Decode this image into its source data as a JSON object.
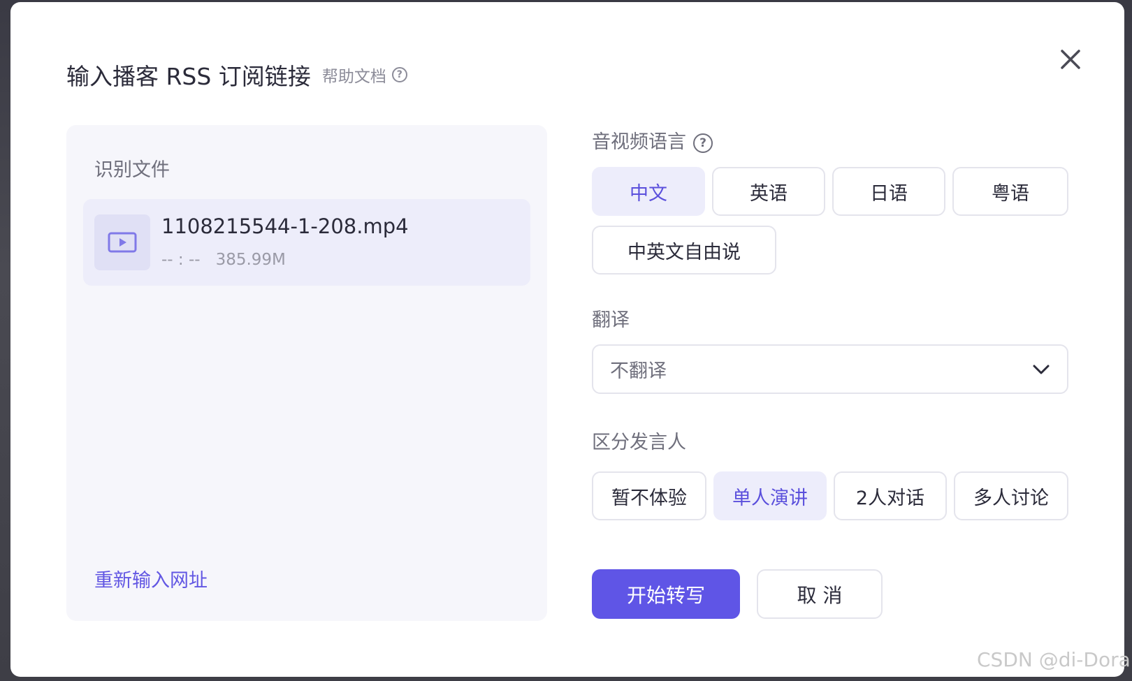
{
  "dialog": {
    "title": "输入播客 RSS 订阅链接",
    "help_link": "帮助文档",
    "help_icon": "question-circle-icon",
    "close_icon": "close-icon"
  },
  "left": {
    "section_label": "识别文件",
    "file": {
      "name": "1108215544-1-208.mp4",
      "duration": "-- : --",
      "size": "385.99M",
      "icon": "video-play-icon"
    },
    "reinput_link": "重新输入网址"
  },
  "language": {
    "label": "音视频语言",
    "options": [
      "中文",
      "英语",
      "日语",
      "粤语",
      "中英文自由说"
    ],
    "selected": "中文"
  },
  "translate": {
    "label": "翻译",
    "value": "不翻译",
    "icon": "chevron-down-icon"
  },
  "speaker": {
    "label": "区分发言人",
    "options": [
      "暂不体验",
      "单人演讲",
      "2人对话",
      "多人讨论"
    ],
    "selected": "单人演讲"
  },
  "actions": {
    "start": "开始转写",
    "cancel": "取 消"
  },
  "watermark": "CSDN @di-Dora",
  "colors": {
    "accent": "#5f55e6",
    "selected_bg": "#ededfb",
    "panel_bg": "#f6f6fb"
  }
}
